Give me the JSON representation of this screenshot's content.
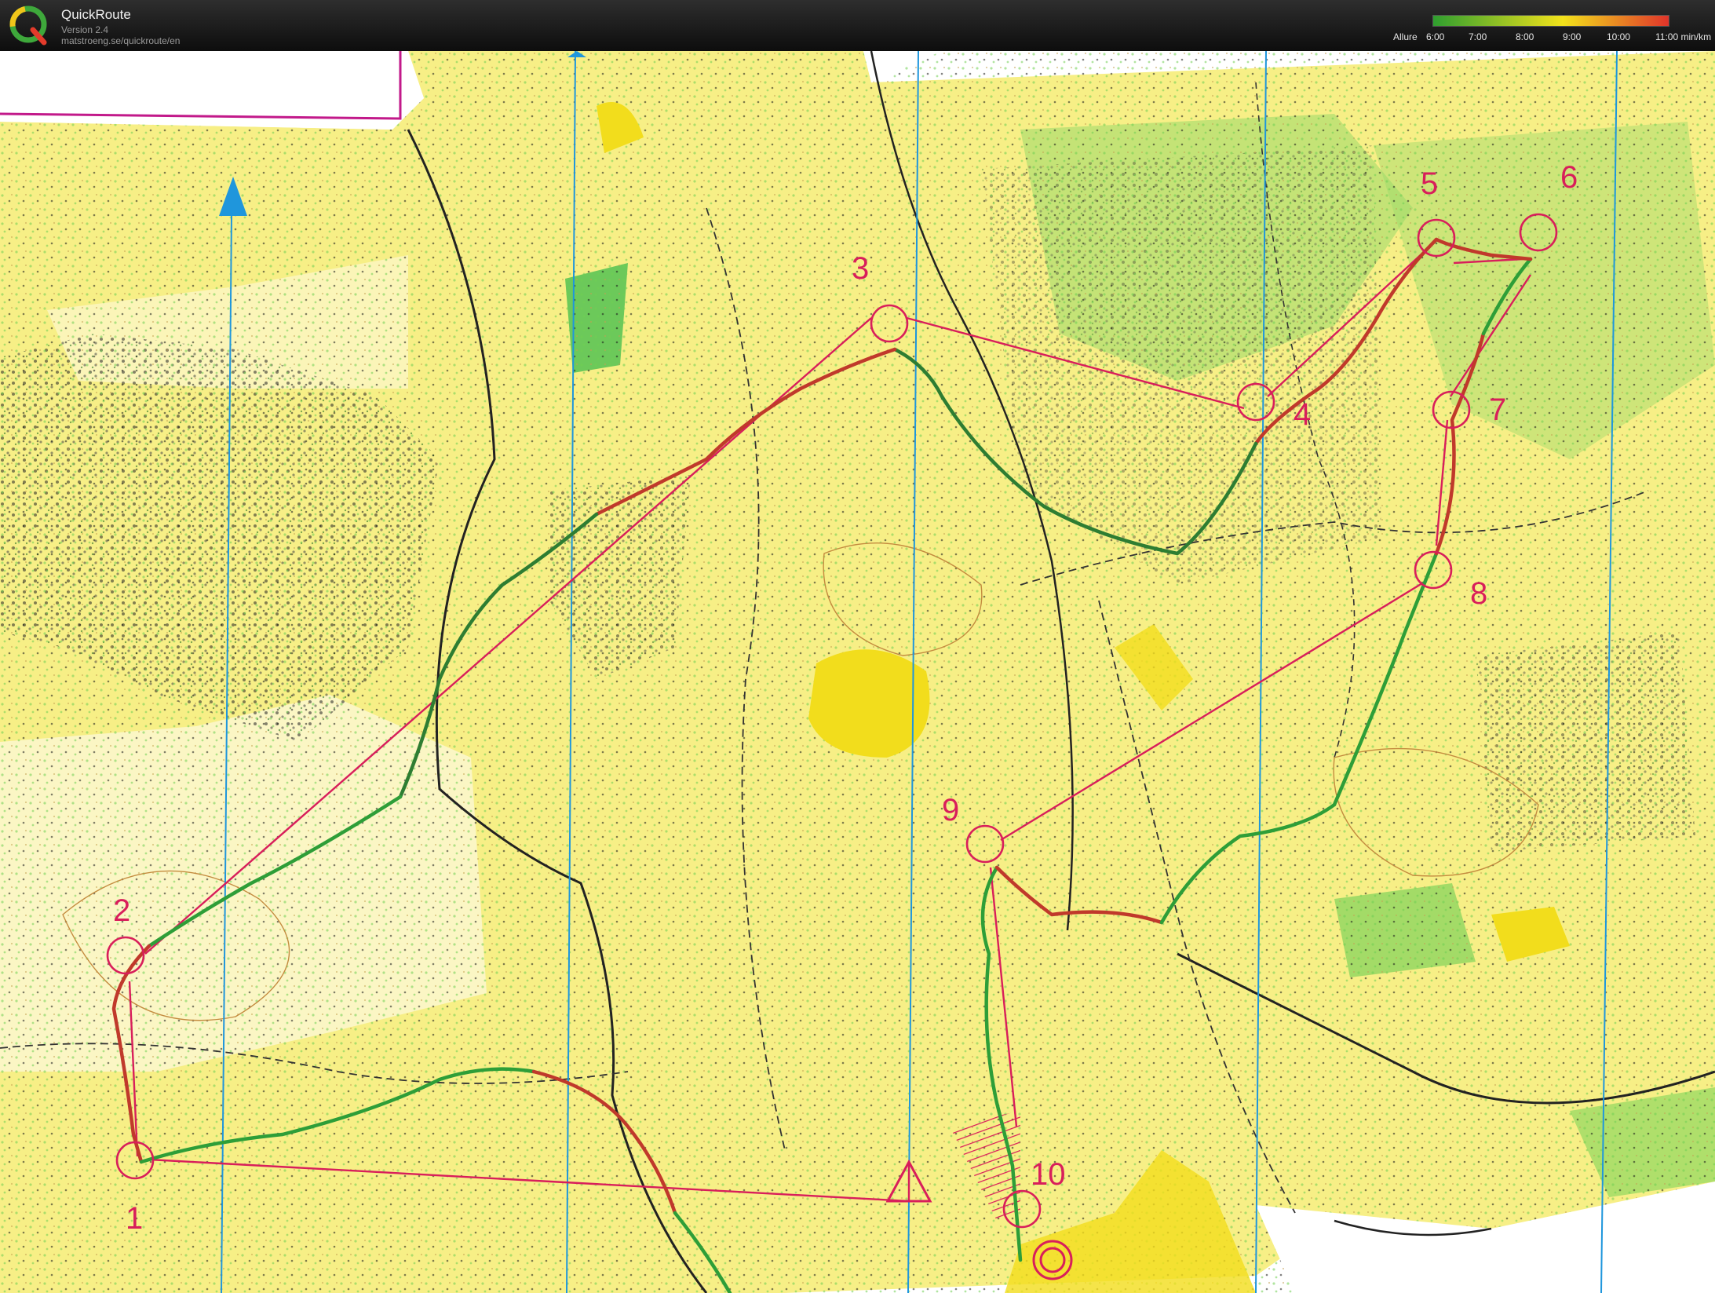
{
  "app": {
    "name": "QuickRoute",
    "version": "Version 2.4",
    "url": "matstroeng.se/quickroute/en"
  },
  "legend": {
    "title": "Allure",
    "ticks": [
      "6:00",
      "7:00",
      "8:00",
      "9:00",
      "10:00",
      "11:00 min/km"
    ],
    "colors": {
      "fast": "#2f9e2f",
      "mid": "#f2e21b",
      "slow": "#e0342a"
    }
  },
  "map": {
    "colors": {
      "open_land": "#f5ec6e",
      "rough_open": "#fbf5b6",
      "forest_green": "#7fd35a",
      "course": "#d81e5b",
      "north_lines": "#1f96dc"
    },
    "controls": [
      {
        "label": "1"
      },
      {
        "label": "2"
      },
      {
        "label": "3"
      },
      {
        "label": "4"
      },
      {
        "label": "5"
      },
      {
        "label": "6"
      },
      {
        "label": "7"
      },
      {
        "label": "8"
      },
      {
        "label": "9"
      },
      {
        "label": "10"
      }
    ],
    "icons": {
      "north_arrow": "north-arrow-icon",
      "start": "start-triangle-icon",
      "finish": "finish-double-circle-icon"
    }
  }
}
